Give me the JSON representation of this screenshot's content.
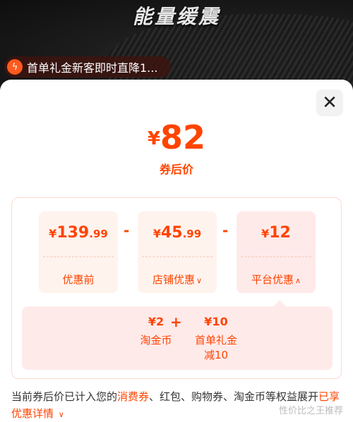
{
  "banner": {
    "slogan": "能量缓震",
    "promo_text": "首单礼金新客即时直降1...",
    "promo_icon": "lightning-icon"
  },
  "sheet": {
    "close_icon": "close-icon",
    "final_price": {
      "currency": "¥",
      "amount": "82"
    },
    "final_label": "券后价",
    "cards": [
      {
        "currency": "¥",
        "integer": "139",
        "decimal": ".99",
        "label": "优惠前"
      },
      {
        "currency": "¥",
        "integer": "45",
        "decimal": ".99",
        "label": "店铺优惠"
      },
      {
        "currency": "¥",
        "integer": "12",
        "decimal": "",
        "label": "平台优惠"
      }
    ],
    "sub_items": [
      {
        "amount": "¥2",
        "name": "淘金币",
        "detail": ""
      },
      {
        "amount": "¥10",
        "name": "首单礼金",
        "detail": "减10"
      }
    ],
    "note": {
      "prefix": "当前券后价已计入您的",
      "highlight": "消费券",
      "suffix": "、红包、购物券、淘金币等权益展开",
      "link": "已享优惠详情"
    },
    "watermark": "性价比之王推荐"
  },
  "colors": {
    "accent": "#ff4400",
    "card_bg": "#fff3ee",
    "platform_bg": "#ffeaea"
  }
}
